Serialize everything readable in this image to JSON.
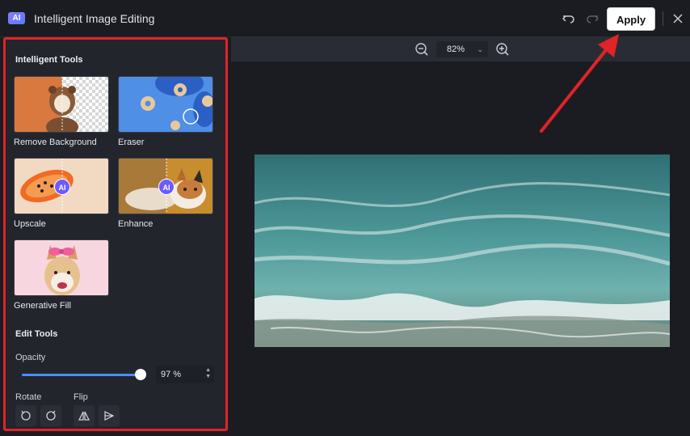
{
  "window": {
    "logo": "AI",
    "title": "Intelligent Image Editing",
    "apply_label": "Apply"
  },
  "sidebar": {
    "intelligent_tools_title": "Intelligent Tools",
    "tools": [
      {
        "label": "Remove Background"
      },
      {
        "label": "Eraser"
      },
      {
        "label": "Upscale",
        "badge": "AI"
      },
      {
        "label": "Enhance",
        "badge": "AI"
      },
      {
        "label": "Generative Fill"
      }
    ],
    "edit_tools_title": "Edit Tools",
    "opacity_label": "Opacity",
    "opacity_value": 97,
    "opacity_display": "97 %",
    "rotate_label": "Rotate",
    "flip_label": "Flip"
  },
  "zoom": {
    "value": "82%"
  },
  "colors": {
    "accent": "#4b8df8",
    "highlight_border": "#e02427",
    "apply_bg": "#ffffff"
  }
}
